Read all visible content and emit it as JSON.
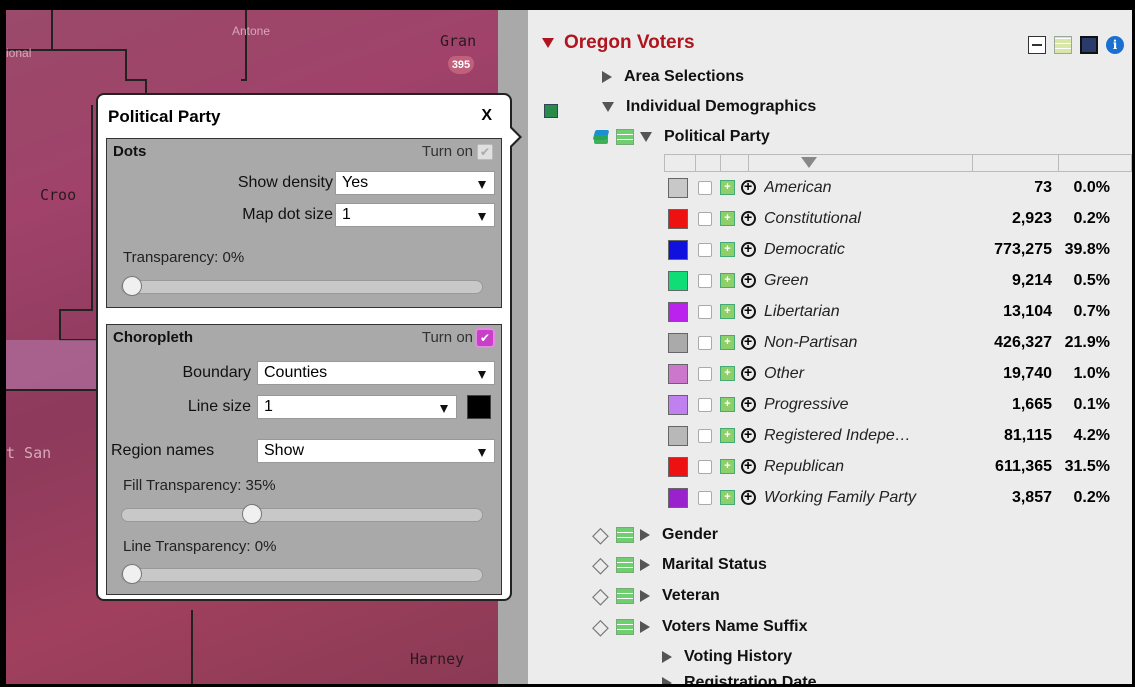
{
  "map": {
    "labels": [
      "Antone",
      "Gran",
      "Croo",
      "t San",
      "Harney",
      "ional"
    ],
    "shield": "395"
  },
  "panel": {
    "title": "Oregon Voters",
    "tree": {
      "area_selections": "Area Selections",
      "individual_demographics": "Individual Demographics",
      "political_party": "Political Party",
      "gender": "Gender",
      "marital_status": "Marital Status",
      "veteran": "Veteran",
      "voters_name_suffix": "Voters Name Suffix",
      "voting_history": "Voting History",
      "registration_date": "Registration Date"
    },
    "legend": [
      {
        "name": "American",
        "count": "73",
        "pct": "0.0%",
        "color": "#c8c8c8"
      },
      {
        "name": "Constitutional",
        "count": "2,923",
        "pct": "0.2%",
        "color": "#ee1111"
      },
      {
        "name": "Democratic",
        "count": "773,275",
        "pct": "39.8%",
        "color": "#1111dd"
      },
      {
        "name": "Green",
        "count": "9,214",
        "pct": "0.5%",
        "color": "#11dd77"
      },
      {
        "name": "Libertarian",
        "count": "13,104",
        "pct": "0.7%",
        "color": "#bb22ee"
      },
      {
        "name": "Non-Partisan",
        "count": "426,327",
        "pct": "21.9%",
        "color": "#aaaaaa"
      },
      {
        "name": "Other",
        "count": "19,740",
        "pct": "1.0%",
        "color": "#cc77cc"
      },
      {
        "name": "Progressive",
        "count": "1,665",
        "pct": "0.1%",
        "color": "#c080f0"
      },
      {
        "name": "Registered Indepe…",
        "count": "81,115",
        "pct": "4.2%",
        "color": "#b8b8b8"
      },
      {
        "name": "Republican",
        "count": "611,365",
        "pct": "31.5%",
        "color": "#ee1111"
      },
      {
        "name": "Working Family Party",
        "count": "3,857",
        "pct": "0.2%",
        "color": "#9922cc"
      }
    ]
  },
  "popup": {
    "title": "Political Party",
    "close": "X",
    "dots": {
      "title": "Dots",
      "turn_on": "Turn on",
      "show_density_label": "Show density",
      "show_density_value": "Yes",
      "map_dot_size_label": "Map dot size",
      "map_dot_size_value": "1",
      "transparency_label": "Transparency:  0%",
      "transparency": 0
    },
    "choropleth": {
      "title": "Choropleth",
      "turn_on": "Turn on",
      "boundary_label": "Boundary",
      "boundary_value": "Counties",
      "line_size_label": "Line size",
      "line_size_value": "1",
      "line_color": "#000000",
      "region_names_label": "Region names",
      "region_names_value": "Show",
      "fill_transparency_label": "Fill Transparency:  35%",
      "fill_transparency": 0.35,
      "line_transparency_label": "Line Transparency:  0%",
      "line_transparency": 0
    }
  }
}
